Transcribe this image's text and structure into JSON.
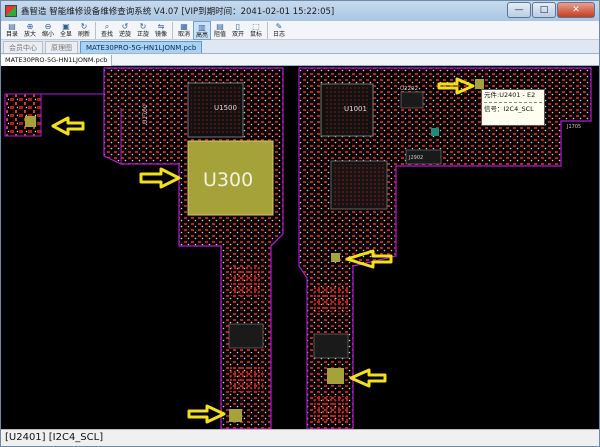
{
  "window": {
    "title": "鑫智造 智能维修设备维修查询系统 V4.07 [VIP到期时间：2041-02-01 15:22:05]",
    "minimize": "—",
    "maximize": "□",
    "close": "✕"
  },
  "toolbar": [
    {
      "name": "catalog",
      "label": "目录",
      "icon": "folder-icon",
      "glyph": "▤"
    },
    {
      "name": "zoom-in",
      "label": "放大",
      "icon": "zoom-in-icon",
      "glyph": "⊕"
    },
    {
      "name": "zoom-out",
      "label": "缩小",
      "icon": "zoom-out-icon",
      "glyph": "⊖"
    },
    {
      "name": "fit-all",
      "label": "全显",
      "icon": "fit-icon",
      "glyph": "▣"
    },
    {
      "name": "refresh",
      "label": "刷新",
      "icon": "refresh-icon",
      "glyph": "↻"
    },
    {
      "name": "search",
      "label": "查找",
      "icon": "search-icon",
      "glyph": "⌕"
    },
    {
      "name": "rotate-ccw",
      "label": "逆旋",
      "icon": "rotate-ccw-icon",
      "glyph": "↺"
    },
    {
      "name": "rotate-cw",
      "label": "正旋",
      "icon": "rotate-cw-icon",
      "glyph": "↻"
    },
    {
      "name": "mirror",
      "label": "镜像",
      "icon": "mirror-icon",
      "glyph": "⇋"
    },
    {
      "name": "cancel",
      "label": "取消",
      "icon": "cancel-icon",
      "glyph": "▦"
    },
    {
      "name": "highlight",
      "label": "高亮",
      "icon": "highlight-icon",
      "glyph": "▥"
    },
    {
      "name": "resistance",
      "label": "阻值",
      "icon": "resistance-icon",
      "glyph": "▤"
    },
    {
      "name": "dual-screen",
      "label": "双开",
      "icon": "dual-screen-icon",
      "glyph": "▯"
    },
    {
      "name": "mouse",
      "label": "鼠标",
      "icon": "mouse-icon",
      "glyph": "⬚"
    },
    {
      "name": "log",
      "label": "日志",
      "icon": "log-icon",
      "glyph": "✎"
    }
  ],
  "tabs": {
    "member": "会员中心",
    "schematic": "原理图",
    "file": "MATE30PRO-5G-HN1LJONM.pcb"
  },
  "doc_tab": "MATE30PRO-5G-HN1LJONM.pcb",
  "board": {
    "labels": {
      "u300": "U300",
      "u1500": "U1500",
      "u1001": "U1001",
      "u2202": "U2202",
      "u1700": "U1700",
      "u2902": "J2902",
      "j1705": "J1705",
      "u1002": "U1002"
    }
  },
  "tooltip": {
    "component": "元件:U2401 - E2",
    "signal": "信号：I2C4_SCL"
  },
  "status": "[U2401]   [I2C4_SCL]",
  "colors": {
    "board_outline": "#b21bd6",
    "pad": "#c2201a",
    "highlight": "#a6a23a",
    "arrow": "#f2e01a",
    "trace": "#e8e8e8"
  }
}
